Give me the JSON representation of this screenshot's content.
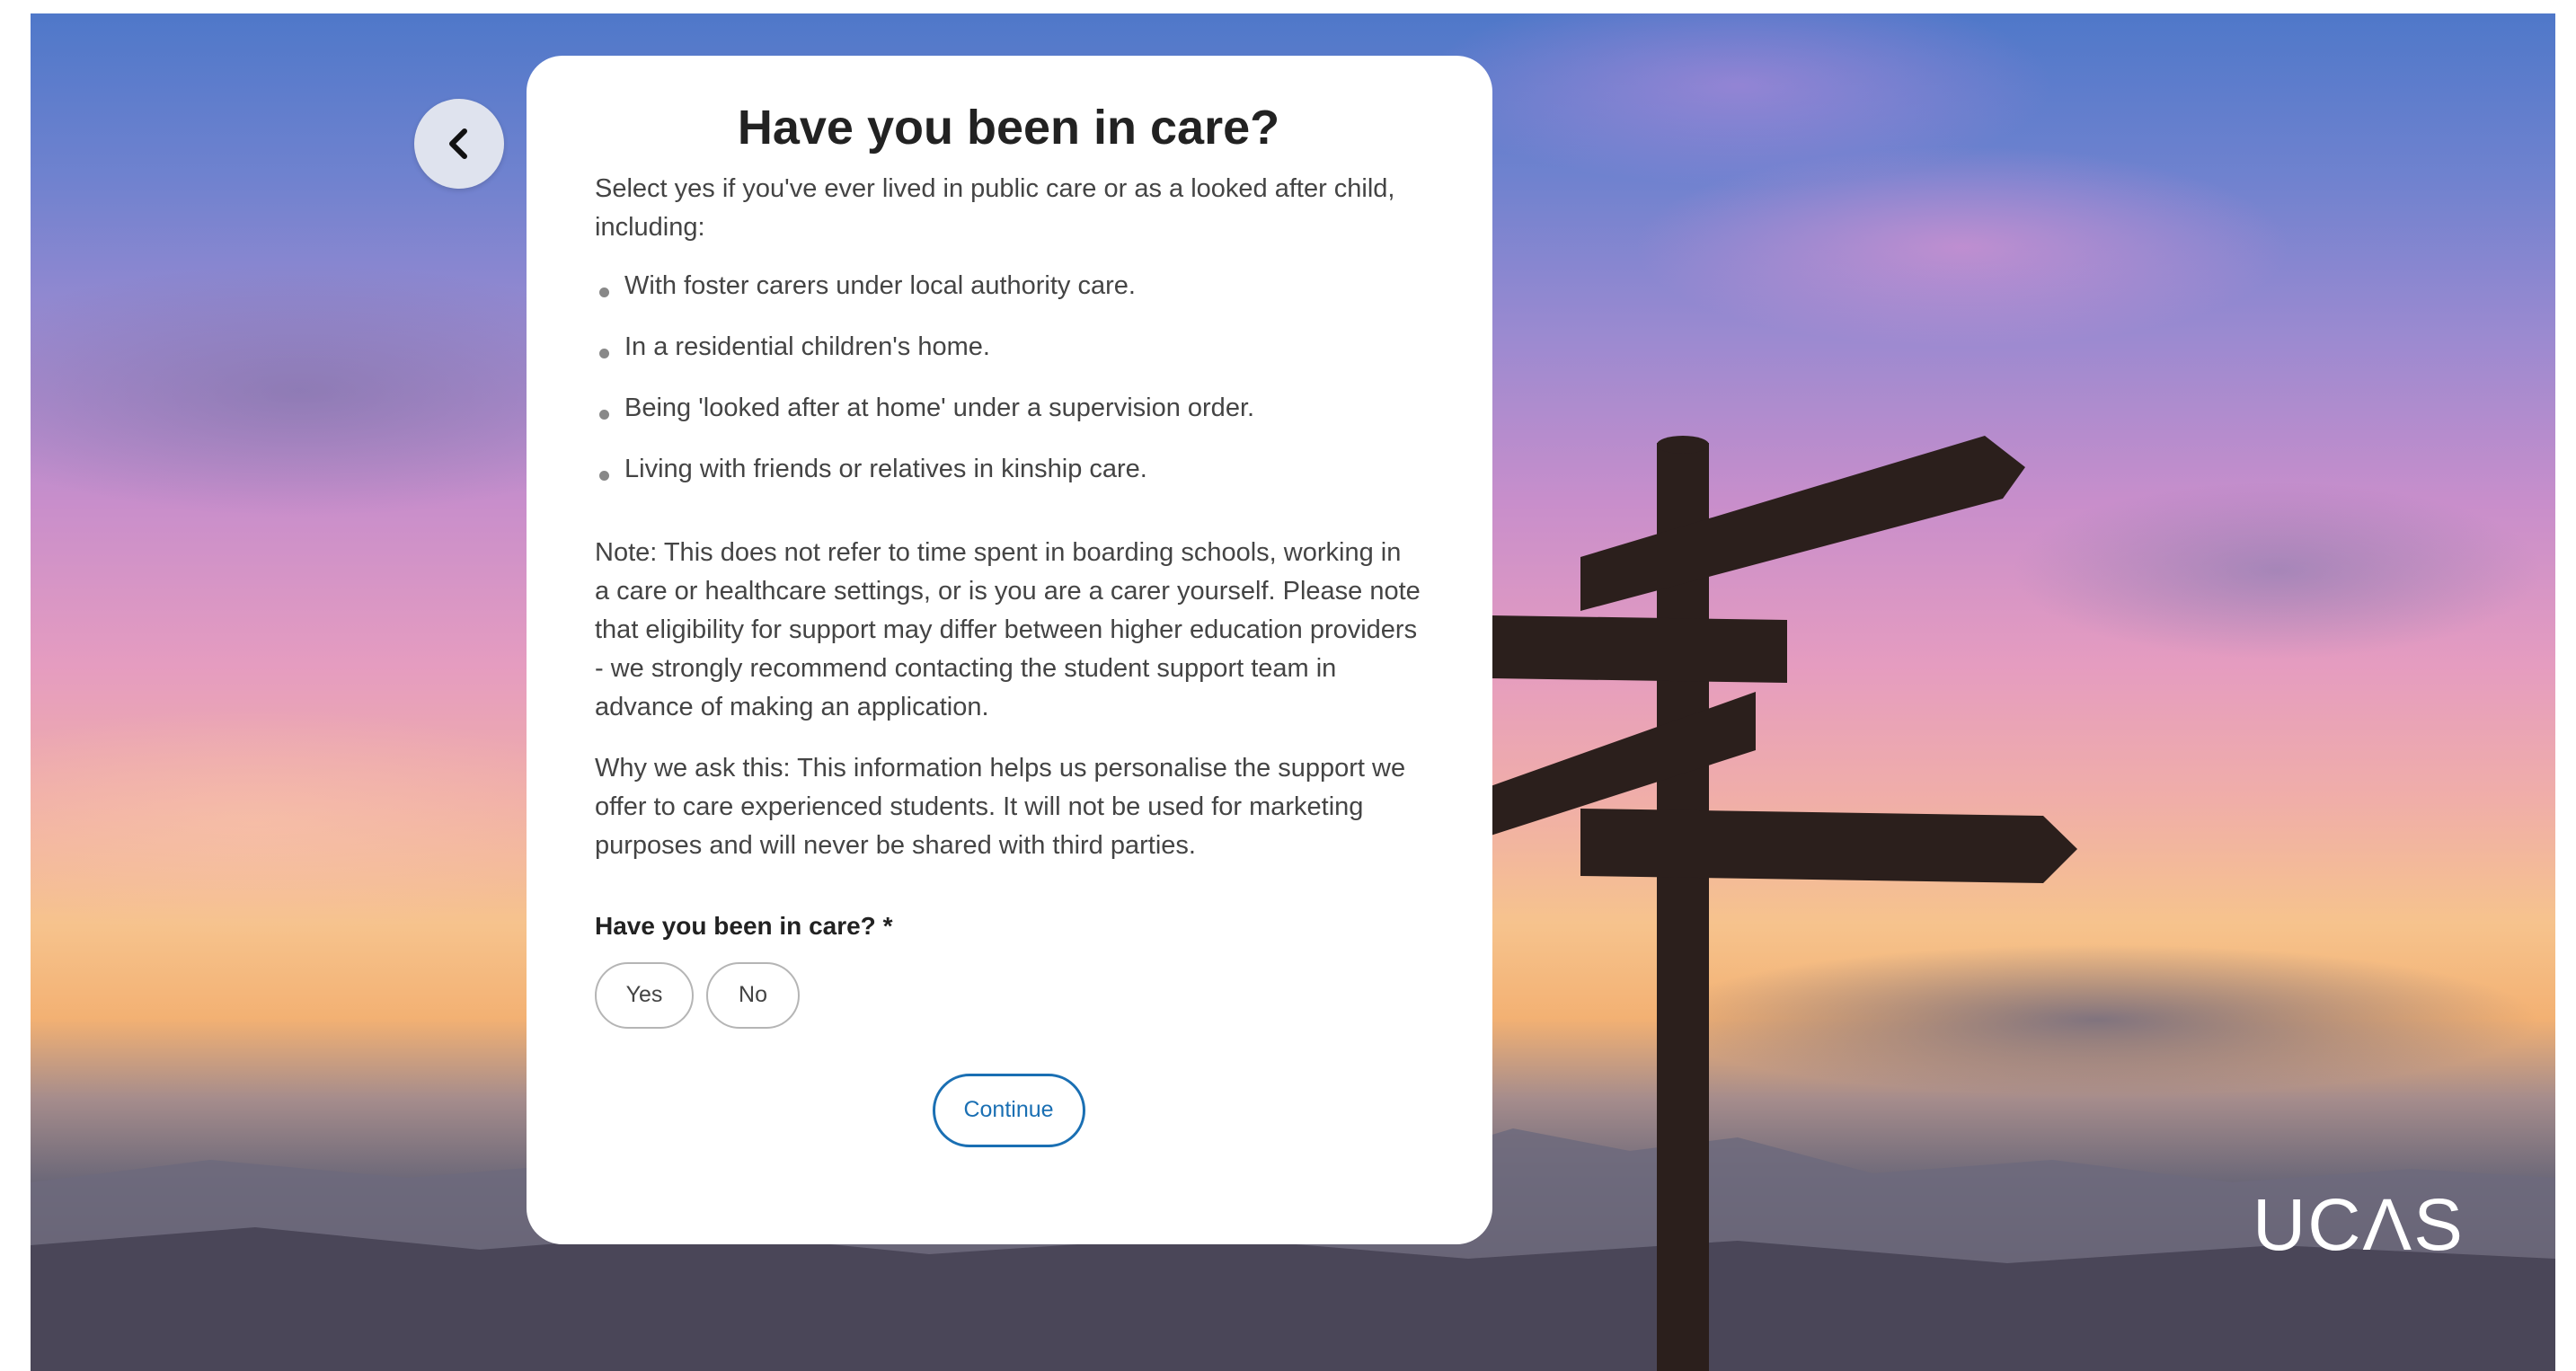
{
  "page": {
    "title": "Have you been in care?",
    "intro": "Select yes if you've ever lived in public care or as a looked after child, including:",
    "bullets": [
      "With foster carers under local authority care.",
      "In a residential children's home.",
      "Being 'looked after at home' under a supervision order.",
      "Living with friends or relatives in kinship care."
    ],
    "note": "Note: This does not refer to time spent in boarding schools, working in a care or healthcare settings, or is you are a carer yourself. Please note that eligibility for support may differ between higher education providers - we strongly recommend contacting the student support team in advance of making an application.",
    "why": "Why we ask this: This information helps us personalise the support we offer to care experienced students. It will not be used for marketing purposes and will never be shared with third parties."
  },
  "question": {
    "label": "Have you been in care? *",
    "options": [
      "Yes",
      "No"
    ]
  },
  "actions": {
    "continue_label": "Continue"
  },
  "branding": {
    "logo_text": "UCΛS"
  },
  "icons": {
    "back": "chevron-left-icon"
  },
  "colors": {
    "accent": "#1a6fb3",
    "card": "#ffffff",
    "back_button": "#dfe3ee"
  }
}
